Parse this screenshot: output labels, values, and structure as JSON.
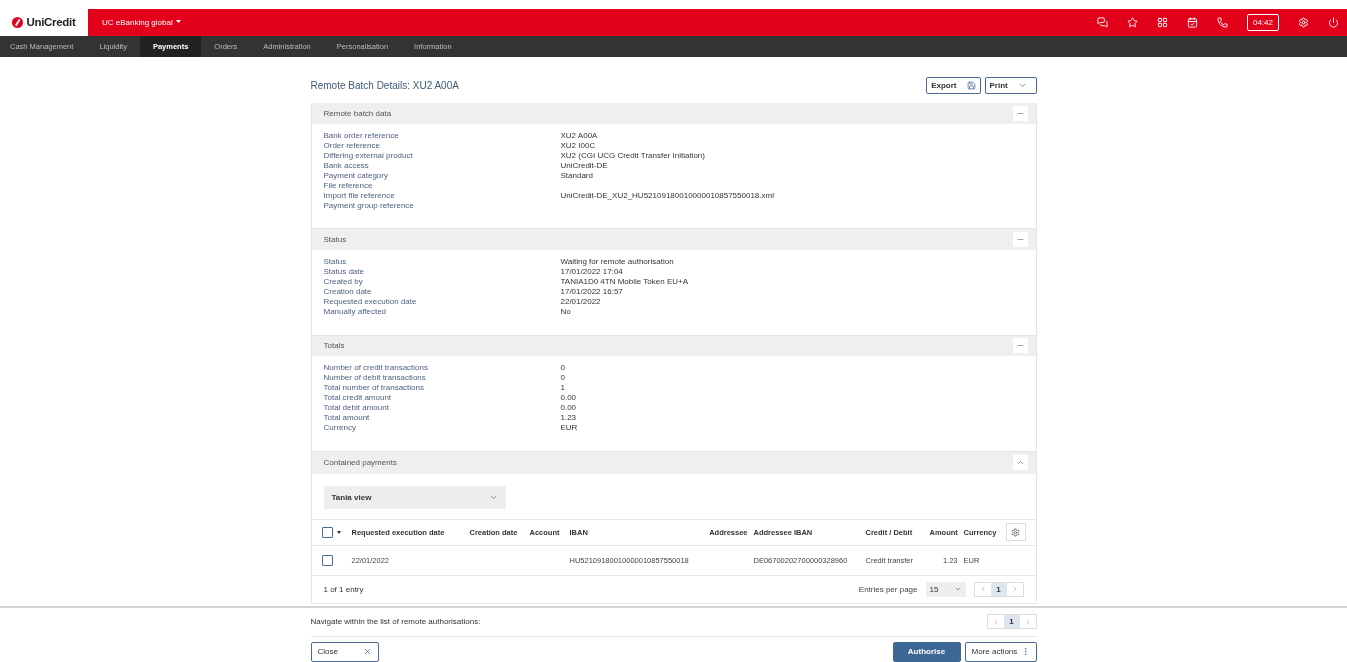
{
  "brand": "UniCredit",
  "app_switcher": "UC eBanking global",
  "timer": "04:42",
  "nav": [
    {
      "label": "Cash Management",
      "selected": false
    },
    {
      "label": "Liquidity",
      "selected": false
    },
    {
      "label": "Payments",
      "selected": true
    },
    {
      "label": "Orders",
      "selected": false
    },
    {
      "label": "Administration",
      "selected": false
    },
    {
      "label": "Personalisation",
      "selected": false
    },
    {
      "label": "Information",
      "selected": false
    }
  ],
  "page_title": "Remote Batch Details: XU2 A00A",
  "toolbar": {
    "export": "Export",
    "print": "Print"
  },
  "sections": [
    {
      "title": "Remote batch data",
      "expanded": true,
      "fields": [
        {
          "label": "Bank order reference",
          "value": "XU2 A00A"
        },
        {
          "label": "Order reference",
          "value": "XU2 I00C"
        },
        {
          "label": "Differing external product",
          "value": "XU2 (CGI UCG Credit Transfer Initiation)"
        },
        {
          "label": "Bank access",
          "value": "UniCredit-DE"
        },
        {
          "label": "Payment category",
          "value": "Standard"
        },
        {
          "label": "File reference"
        },
        {
          "label": "Import file reference",
          "value": "UniCredit-DE_XU2_HU52109180010000010857550018.xml"
        },
        {
          "label": "Payment group reference"
        }
      ]
    },
    {
      "title": "Status",
      "expanded": true,
      "fields": [
        {
          "label": "Status",
          "value": "Waiting for remote authorisation"
        },
        {
          "label": "Status date",
          "value": "17/01/2022 17:04"
        },
        {
          "label": "Created by",
          "value": "TANIA1D0 4TN Mobile Token EU+A"
        },
        {
          "label": "Creation date",
          "value": "17/01/2022 16:57"
        },
        {
          "label": "Requested execution date",
          "value": "22/01/2022"
        },
        {
          "label": "Manually affected",
          "value": "No"
        }
      ]
    },
    {
      "title": "Totals",
      "expanded": true,
      "fields": [
        {
          "label": "Number of credit transactions",
          "value": "0"
        },
        {
          "label": "Number of debit transactions",
          "value": "0"
        },
        {
          "label": "Total number of transactions",
          "value": "1"
        },
        {
          "label": "Total credit amount",
          "value": "0.00"
        },
        {
          "label": "Total debit amount",
          "value": "0.00"
        },
        {
          "label": "Total amount",
          "value": "1.23"
        },
        {
          "label": "Currency",
          "value": "EUR"
        }
      ]
    }
  ],
  "contained_payments": {
    "title": "Contained payments",
    "expanded": true,
    "view": "Tania view",
    "select_all": {
      "checked": false
    },
    "columns": [
      "Requested execution date",
      "Creation date",
      "Account",
      "IBAN",
      "Addressee",
      "Addressee IBAN",
      "Credit / Debit",
      "Amount",
      "Currency"
    ],
    "rows": [
      {
        "selected": false,
        "cells": [
          "22/01/2022",
          null,
          null,
          "HU52109180010000010857550018",
          null,
          "DE06700202700000328960",
          "Credit transfer",
          "1.23",
          "EUR"
        ]
      }
    ],
    "count": "1 of 1 entry",
    "entries_per_page_label": "Entries per page",
    "entries_per_page": "15",
    "pages": [
      {
        "label": "1",
        "selected": true
      }
    ]
  },
  "navigate": {
    "label": "Navigate within the list of remote authorisations:",
    "pages": [
      {
        "label": "1",
        "selected": true
      }
    ]
  },
  "footer_buttons": [
    {
      "label": "Close",
      "kind": "close"
    },
    {
      "label": "Authorise",
      "kind": "primary"
    },
    {
      "label": "More actions",
      "kind": "more"
    }
  ]
}
